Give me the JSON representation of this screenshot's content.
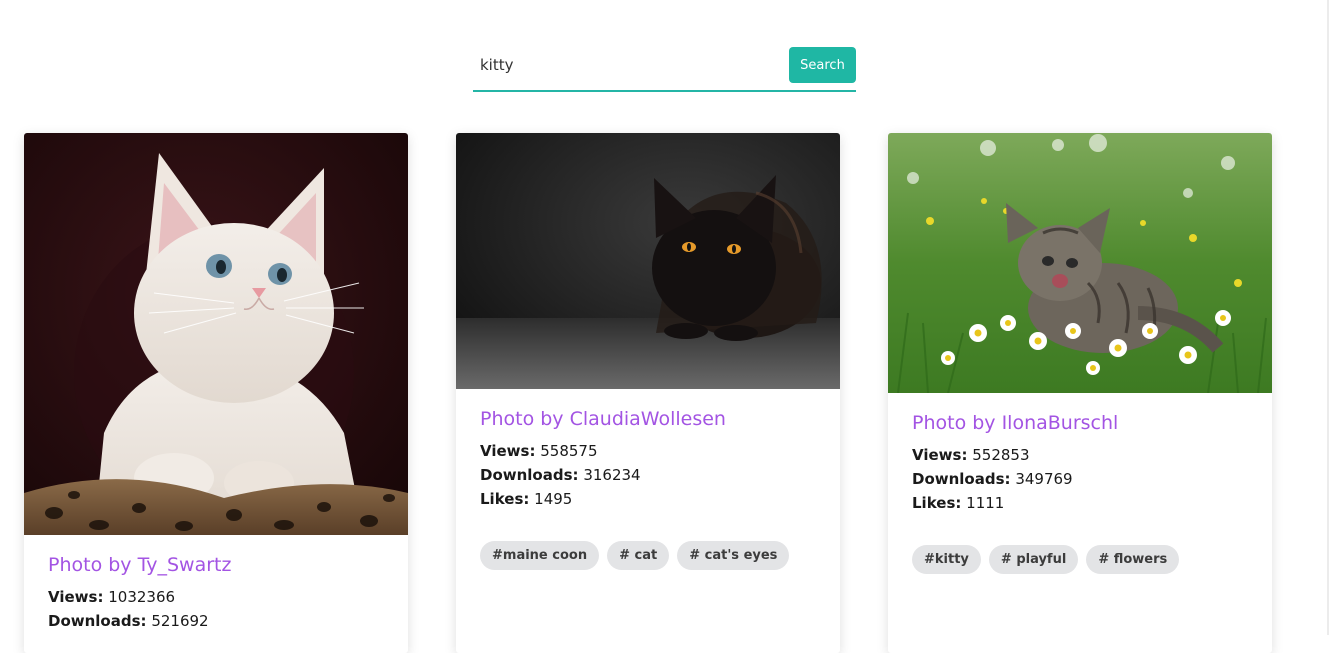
{
  "search": {
    "query": "kitty",
    "button_label": "Search"
  },
  "cards": [
    {
      "author": "Photo by Ty_Swartz",
      "views_label": "Views:",
      "views": "1032366",
      "downloads_label": "Downloads:",
      "downloads": "521692"
    },
    {
      "author": "Photo by ClaudiaWollesen",
      "views_label": "Views:",
      "views": "558575",
      "downloads_label": "Downloads:",
      "downloads": "316234",
      "likes_label": "Likes:",
      "likes": "1495",
      "tags": [
        "#maine coon",
        "# cat",
        "# cat's eyes"
      ]
    },
    {
      "author": "Photo by IlonaBurschl",
      "views_label": "Views:",
      "views": "552853",
      "downloads_label": "Downloads:",
      "downloads": "349769",
      "likes_label": "Likes:",
      "likes": "1111",
      "tags": [
        "#kitty",
        "# playful",
        "# flowers"
      ]
    }
  ],
  "colors": {
    "accent": "#1fb7a4",
    "author_link": "#a354e3",
    "tag_background": "#e3e4e6"
  }
}
